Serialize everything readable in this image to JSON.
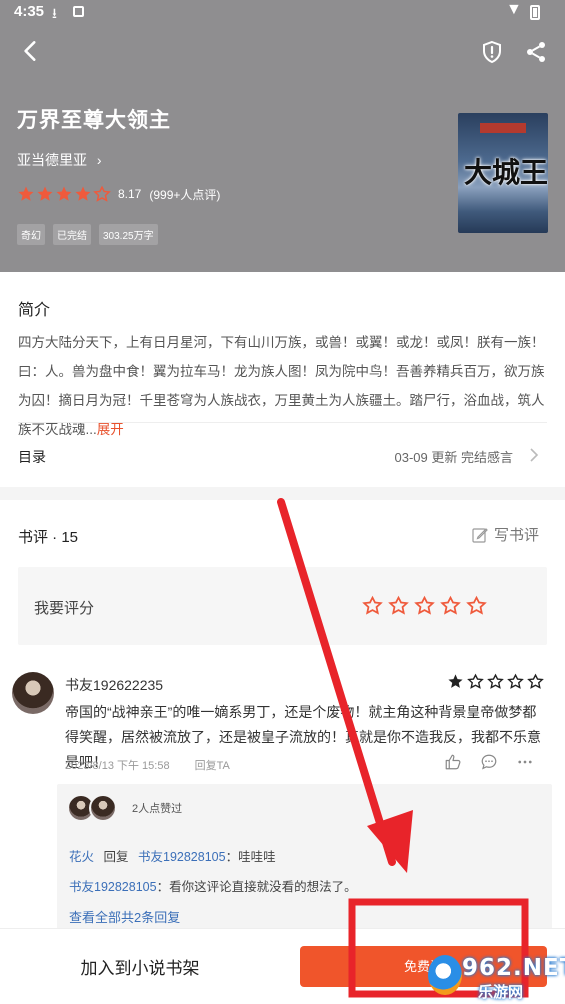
{
  "status": {
    "time": "4:35"
  },
  "book": {
    "title": "万界至尊大领主",
    "author": "亚当德里亚",
    "score": "8.17",
    "rating_count": "(999+人点评)",
    "rating_stars": 4.5,
    "tags": [
      "奇幻",
      "已完结",
      "303.25万字"
    ],
    "cover_text": "大城王"
  },
  "intro": {
    "heading": "简介",
    "text": "四方大陆分天下，上有日月星河，下有山川万族，或兽！或翼！或龙！或凤！朕有一族！曰：人。兽为盘中食！翼为拉车马！龙为族人图！凤为院中鸟！吾善养精兵百万，欲万族为囚！摘日月为冠！千里苍穹为人族战衣，万里黄土为人族疆土。踏尸行，浴血战，筑人族不灭战魂...",
    "more": "展开"
  },
  "toc": {
    "label": "目录",
    "info": "03-09  更新  完结感言"
  },
  "reviews": {
    "title": "书评 · 15",
    "write": "写书评",
    "rate_label": "我要评分",
    "comment": {
      "user": "书友192622235",
      "stars": 1,
      "text": "帝国的“战神亲王”的唯一嫡系男丁，还是个废物！就主角这种背景皇帝做梦都得笑醒，居然被流放了，还是被皇子流放的！真就是你不造我反，我都不乐意是吧！",
      "date": "2023/8/13 下午 15:58",
      "reply_to": "回复TA",
      "likes": "2人点赞过",
      "replies": [
        {
          "from": "花火",
          "verb": "回复",
          "to": "书友192828105",
          "text": "：哇哇哇"
        },
        {
          "from": "书友192828105",
          "verb": "",
          "to": "",
          "text": "：看你这评论直接就没看的想法了。"
        }
      ],
      "see_all": "查看全部共2条回复"
    }
  },
  "bottom": {
    "add_shelf": "加入到小说书架",
    "read": "免费阅"
  },
  "watermark": {
    "top": "962.NET",
    "bottom": "乐游网"
  },
  "colors": {
    "accent": "#f0552b",
    "link": "#3b6fb8",
    "header_bg": "#8f8e90",
    "annotation": "#e8242a"
  }
}
